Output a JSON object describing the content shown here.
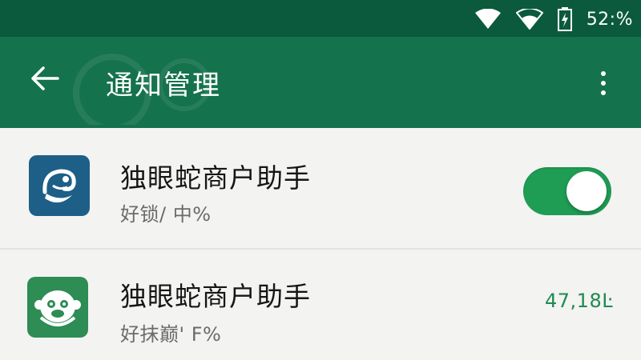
{
  "status_bar": {
    "battery_text": "52:%",
    "icons": [
      "wifi-full-icon",
      "wifi-icon",
      "battery-charging-icon"
    ]
  },
  "app_bar": {
    "title": "通知管理",
    "back_icon": "arrow-left-icon",
    "more_icon": "more-vertical-icon"
  },
  "list": {
    "items": [
      {
        "name": "独眼蛇商户助手",
        "subtitle": "好锁/ 中%",
        "icon": "snake-app-icon",
        "icon_color": "#1d5f86",
        "toggle_on": true
      },
      {
        "name": "独眼蛇商户助手",
        "subtitle": "好抹巅' F%",
        "icon": "monkey-app-icon",
        "icon_color": "#2e8c55",
        "value": "47,18Ŀ"
      }
    ]
  },
  "colors": {
    "status_bar": "#0b5a3d",
    "app_bar": "#14724d",
    "toggle_on": "#1f9d54",
    "background": "#f3f3f1"
  }
}
